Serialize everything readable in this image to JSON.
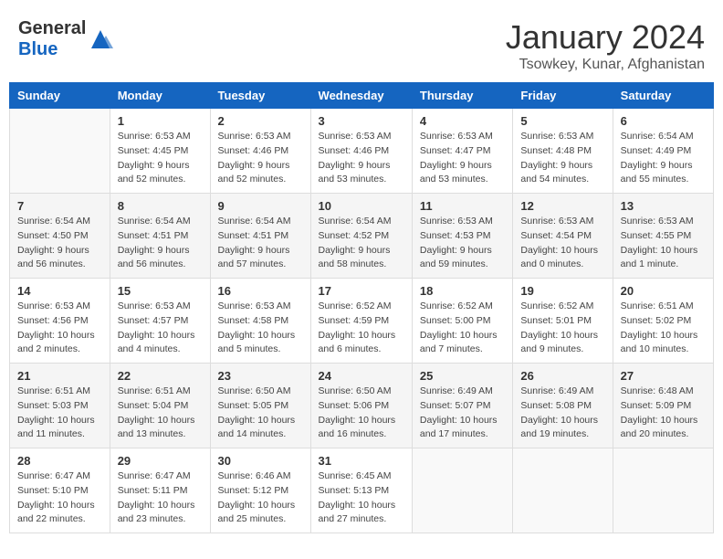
{
  "header": {
    "logo_general": "General",
    "logo_blue": "Blue",
    "month": "January 2024",
    "location": "Tsowkey, Kunar, Afghanistan"
  },
  "weekdays": [
    "Sunday",
    "Monday",
    "Tuesday",
    "Wednesday",
    "Thursday",
    "Friday",
    "Saturday"
  ],
  "weeks": [
    [
      {
        "day": "",
        "info": ""
      },
      {
        "day": "1",
        "info": "Sunrise: 6:53 AM\nSunset: 4:45 PM\nDaylight: 9 hours\nand 52 minutes."
      },
      {
        "day": "2",
        "info": "Sunrise: 6:53 AM\nSunset: 4:46 PM\nDaylight: 9 hours\nand 52 minutes."
      },
      {
        "day": "3",
        "info": "Sunrise: 6:53 AM\nSunset: 4:46 PM\nDaylight: 9 hours\nand 53 minutes."
      },
      {
        "day": "4",
        "info": "Sunrise: 6:53 AM\nSunset: 4:47 PM\nDaylight: 9 hours\nand 53 minutes."
      },
      {
        "day": "5",
        "info": "Sunrise: 6:53 AM\nSunset: 4:48 PM\nDaylight: 9 hours\nand 54 minutes."
      },
      {
        "day": "6",
        "info": "Sunrise: 6:54 AM\nSunset: 4:49 PM\nDaylight: 9 hours\nand 55 minutes."
      }
    ],
    [
      {
        "day": "7",
        "info": "Sunrise: 6:54 AM\nSunset: 4:50 PM\nDaylight: 9 hours\nand 56 minutes."
      },
      {
        "day": "8",
        "info": "Sunrise: 6:54 AM\nSunset: 4:51 PM\nDaylight: 9 hours\nand 56 minutes."
      },
      {
        "day": "9",
        "info": "Sunrise: 6:54 AM\nSunset: 4:51 PM\nDaylight: 9 hours\nand 57 minutes."
      },
      {
        "day": "10",
        "info": "Sunrise: 6:54 AM\nSunset: 4:52 PM\nDaylight: 9 hours\nand 58 minutes."
      },
      {
        "day": "11",
        "info": "Sunrise: 6:53 AM\nSunset: 4:53 PM\nDaylight: 9 hours\nand 59 minutes."
      },
      {
        "day": "12",
        "info": "Sunrise: 6:53 AM\nSunset: 4:54 PM\nDaylight: 10 hours\nand 0 minutes."
      },
      {
        "day": "13",
        "info": "Sunrise: 6:53 AM\nSunset: 4:55 PM\nDaylight: 10 hours\nand 1 minute."
      }
    ],
    [
      {
        "day": "14",
        "info": "Sunrise: 6:53 AM\nSunset: 4:56 PM\nDaylight: 10 hours\nand 2 minutes."
      },
      {
        "day": "15",
        "info": "Sunrise: 6:53 AM\nSunset: 4:57 PM\nDaylight: 10 hours\nand 4 minutes."
      },
      {
        "day": "16",
        "info": "Sunrise: 6:53 AM\nSunset: 4:58 PM\nDaylight: 10 hours\nand 5 minutes."
      },
      {
        "day": "17",
        "info": "Sunrise: 6:52 AM\nSunset: 4:59 PM\nDaylight: 10 hours\nand 6 minutes."
      },
      {
        "day": "18",
        "info": "Sunrise: 6:52 AM\nSunset: 5:00 PM\nDaylight: 10 hours\nand 7 minutes."
      },
      {
        "day": "19",
        "info": "Sunrise: 6:52 AM\nSunset: 5:01 PM\nDaylight: 10 hours\nand 9 minutes."
      },
      {
        "day": "20",
        "info": "Sunrise: 6:51 AM\nSunset: 5:02 PM\nDaylight: 10 hours\nand 10 minutes."
      }
    ],
    [
      {
        "day": "21",
        "info": "Sunrise: 6:51 AM\nSunset: 5:03 PM\nDaylight: 10 hours\nand 11 minutes."
      },
      {
        "day": "22",
        "info": "Sunrise: 6:51 AM\nSunset: 5:04 PM\nDaylight: 10 hours\nand 13 minutes."
      },
      {
        "day": "23",
        "info": "Sunrise: 6:50 AM\nSunset: 5:05 PM\nDaylight: 10 hours\nand 14 minutes."
      },
      {
        "day": "24",
        "info": "Sunrise: 6:50 AM\nSunset: 5:06 PM\nDaylight: 10 hours\nand 16 minutes."
      },
      {
        "day": "25",
        "info": "Sunrise: 6:49 AM\nSunset: 5:07 PM\nDaylight: 10 hours\nand 17 minutes."
      },
      {
        "day": "26",
        "info": "Sunrise: 6:49 AM\nSunset: 5:08 PM\nDaylight: 10 hours\nand 19 minutes."
      },
      {
        "day": "27",
        "info": "Sunrise: 6:48 AM\nSunset: 5:09 PM\nDaylight: 10 hours\nand 20 minutes."
      }
    ],
    [
      {
        "day": "28",
        "info": "Sunrise: 6:47 AM\nSunset: 5:10 PM\nDaylight: 10 hours\nand 22 minutes."
      },
      {
        "day": "29",
        "info": "Sunrise: 6:47 AM\nSunset: 5:11 PM\nDaylight: 10 hours\nand 23 minutes."
      },
      {
        "day": "30",
        "info": "Sunrise: 6:46 AM\nSunset: 5:12 PM\nDaylight: 10 hours\nand 25 minutes."
      },
      {
        "day": "31",
        "info": "Sunrise: 6:45 AM\nSunset: 5:13 PM\nDaylight: 10 hours\nand 27 minutes."
      },
      {
        "day": "",
        "info": ""
      },
      {
        "day": "",
        "info": ""
      },
      {
        "day": "",
        "info": ""
      }
    ]
  ]
}
